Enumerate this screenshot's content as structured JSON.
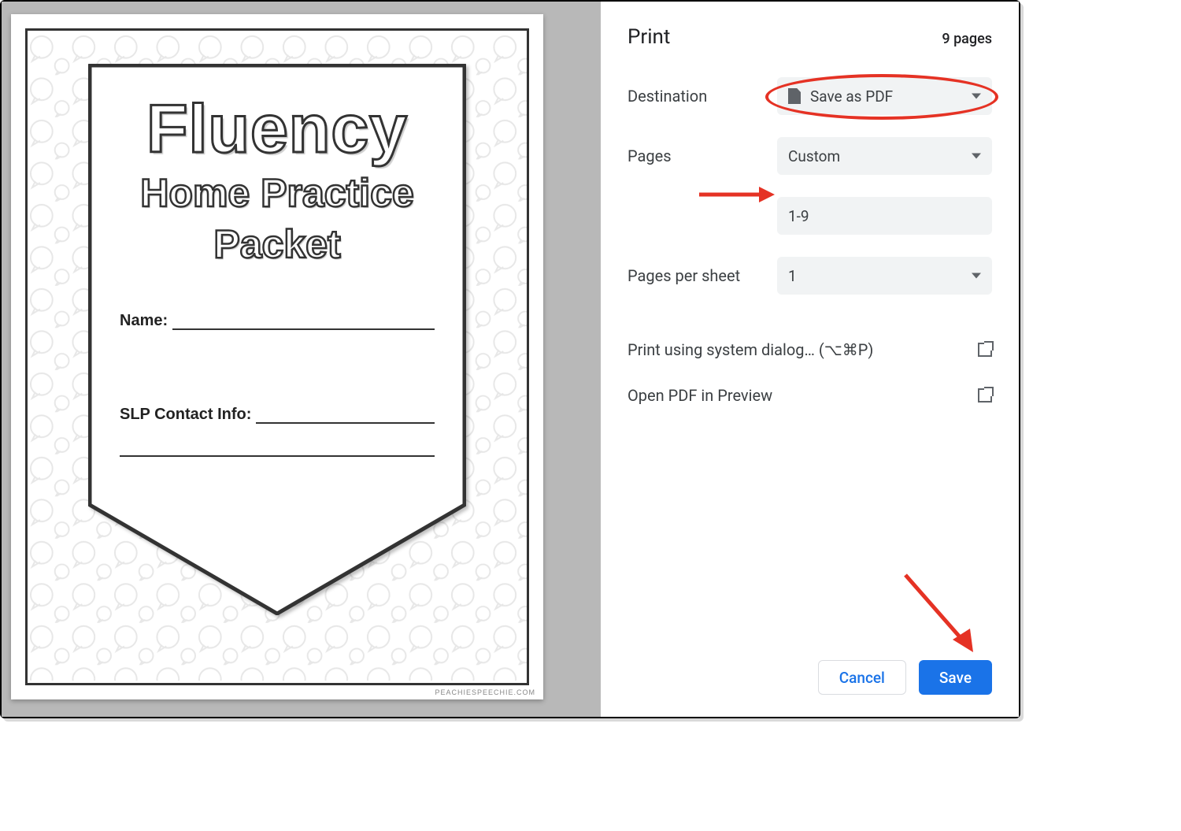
{
  "preview": {
    "title_line1": "Fluency",
    "title_line2": "Home Practice",
    "title_line3": "Packet",
    "name_label": "Name:",
    "contact_label": "SLP Contact Info:",
    "footer_url": "PEACHIESPEECHIE.COM"
  },
  "panel": {
    "header_title": "Print",
    "page_count": "9 pages",
    "destination_label": "Destination",
    "destination_value": "Save as PDF",
    "pages_label": "Pages",
    "pages_mode": "Custom",
    "pages_value": "1-9",
    "pps_label": "Pages per sheet",
    "pps_value": "1",
    "system_dialog": "Print using system dialog… (⌥⌘P)",
    "open_preview": "Open PDF in Preview",
    "cancel": "Cancel",
    "save": "Save"
  }
}
